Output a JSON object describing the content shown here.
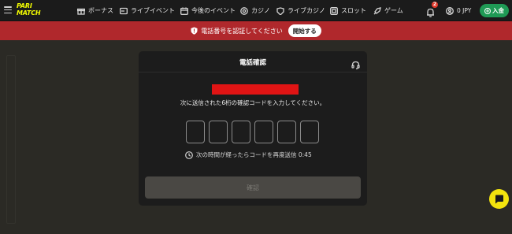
{
  "nav": {
    "logo_line1": "PARI",
    "logo_line2": "MATCH",
    "items": [
      {
        "label": "ボーナス",
        "icon": "gift-icon"
      },
      {
        "label": "ライブイベント",
        "icon": "live-icon"
      },
      {
        "label": "今後のイベント",
        "icon": "calendar-icon"
      },
      {
        "label": "カジノ",
        "icon": "casino-icon"
      },
      {
        "label": "ライブカジノ",
        "icon": "live-casino-icon"
      },
      {
        "label": "スロット",
        "icon": "slot-icon"
      },
      {
        "label": "ゲーム",
        "icon": "rocket-icon"
      }
    ],
    "notification_count": "2",
    "balance": "0 JPY",
    "deposit_label": "入金"
  },
  "banner": {
    "text": "電話番号を認証してください",
    "button_label": "開始する"
  },
  "modal": {
    "title": "電話確認",
    "instruction": "次に送信された6桁の確認コードを入力してください。",
    "code_length": 6,
    "resend_text": "次の時間が経ったらコードを再度送信 0:45",
    "confirm_label": "確認"
  },
  "colors": {
    "brand_yellow": "#f6ff00",
    "banner_red": "#b0282c",
    "deposit_green": "#1f9a55",
    "chat_yellow": "#f3e40e"
  }
}
